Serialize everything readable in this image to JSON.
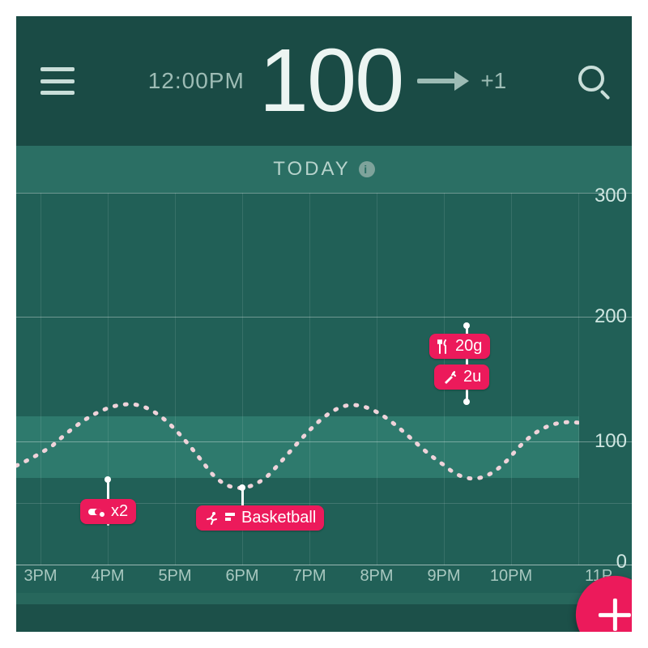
{
  "header": {
    "time": "12:00PM",
    "glucose_value": "100",
    "trend_delta": "+1"
  },
  "chart_title": "TODAY",
  "chart_data": {
    "type": "line",
    "title": "TODAY",
    "xlabel": "",
    "ylabel": "",
    "ylim": [
      0,
      300
    ],
    "target_range": [
      70,
      120
    ],
    "x_ticks": [
      "3PM",
      "4PM",
      "5PM",
      "6PM",
      "7PM",
      "8PM",
      "9PM",
      "10PM",
      "11P"
    ],
    "x": [
      "2:40PM",
      "3PM",
      "4PM",
      "5PM",
      "6PM",
      "7PM",
      "8PM",
      "9PM",
      "10PM",
      "11PM"
    ],
    "values": [
      80,
      90,
      130,
      110,
      65,
      110,
      130,
      100,
      70,
      115
    ],
    "events": [
      {
        "time": "4PM",
        "y": 50,
        "type": "meds",
        "label": "x2",
        "icon": "pill"
      },
      {
        "time": "6PM",
        "y": 40,
        "type": "exercise",
        "label": "Basketball",
        "icon": "runner"
      },
      {
        "time": "9:20PM",
        "y": 170,
        "type": "food",
        "label": "20g",
        "icon": "fork-knife"
      },
      {
        "time": "9:20PM",
        "y": 145,
        "type": "insulin",
        "label": "2u",
        "icon": "syringe"
      }
    ]
  },
  "events": {
    "meds_label": "x2",
    "exercise_label": "Basketball",
    "food_label": "20g",
    "insulin_label": "2u"
  },
  "colors": {
    "bg_deep": "#1a4b45",
    "bg_chart": "#216057",
    "band": "#2e7a6d",
    "accent": "#ec1a5b"
  }
}
